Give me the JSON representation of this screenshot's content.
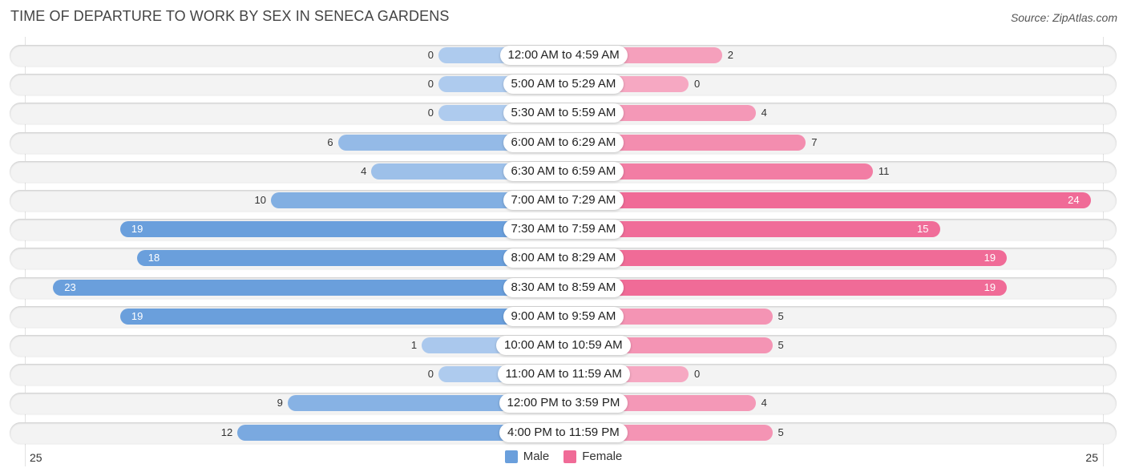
{
  "header": {
    "title": "TIME OF DEPARTURE TO WORK BY SEX IN SENECA GARDENS",
    "source": "Source: ZipAtlas.com"
  },
  "chart_data": {
    "type": "bar",
    "orientation": "horizontal-diverging",
    "title": "TIME OF DEPARTURE TO WORK BY SEX IN SENECA GARDENS",
    "xlabel": "",
    "ylabel": "",
    "categories": [
      "12:00 AM to 4:59 AM",
      "5:00 AM to 5:29 AM",
      "5:30 AM to 5:59 AM",
      "6:00 AM to 6:29 AM",
      "6:30 AM to 6:59 AM",
      "7:00 AM to 7:29 AM",
      "7:30 AM to 7:59 AM",
      "8:00 AM to 8:29 AM",
      "8:30 AM to 8:59 AM",
      "9:00 AM to 9:59 AM",
      "10:00 AM to 10:59 AM",
      "11:00 AM to 11:59 AM",
      "12:00 PM to 3:59 PM",
      "4:00 PM to 11:59 PM"
    ],
    "series": [
      {
        "name": "Male",
        "color": "#6a9fdc",
        "values": [
          0,
          0,
          0,
          6,
          4,
          10,
          19,
          18,
          23,
          19,
          1,
          0,
          9,
          12
        ]
      },
      {
        "name": "Female",
        "color": "#f06b97",
        "values": [
          2,
          0,
          4,
          7,
          11,
          24,
          15,
          19,
          19,
          5,
          5,
          0,
          4,
          5
        ]
      }
    ],
    "axis": {
      "left_tick": "25",
      "right_tick": "25",
      "xlim": [
        -25,
        25
      ]
    },
    "legend": {
      "placement": "bottom-center",
      "entries": [
        "Male",
        "Female"
      ]
    },
    "grid": false
  }
}
